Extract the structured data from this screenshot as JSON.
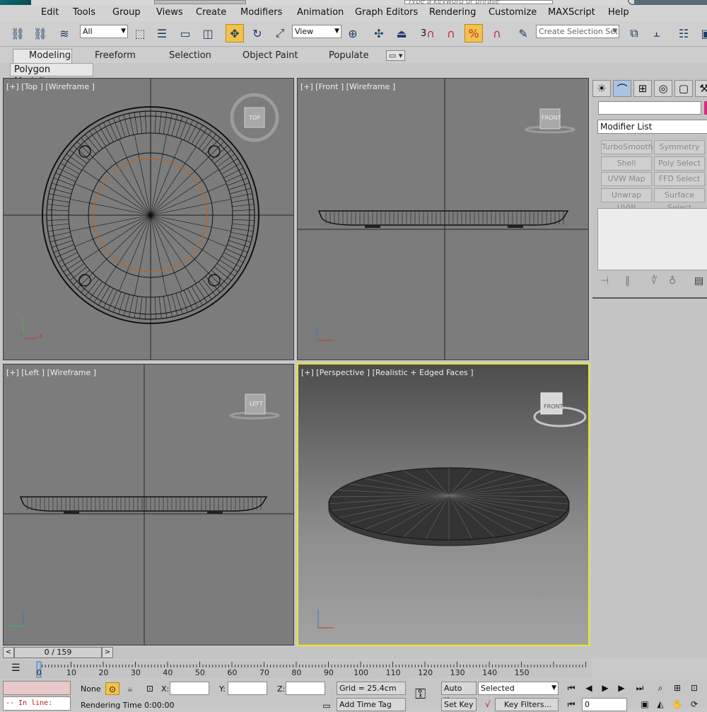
{
  "window": {
    "search_placeholder": "Type a keyword or phrase"
  },
  "menu": {
    "items": [
      "Edit",
      "Tools",
      "Group",
      "Views",
      "Create",
      "Modifiers",
      "Animation",
      "Graph Editors",
      "Rendering",
      "Customize",
      "MAXScript",
      "Help"
    ]
  },
  "toolbar": {
    "selection_filter": "All",
    "reference_coord": "View",
    "named_selection_placeholder": "Create Selection Set",
    "snap_label": "3"
  },
  "ribbon": {
    "tabs": [
      "Modeling",
      "Freeform",
      "Selection",
      "Object Paint",
      "Populate"
    ],
    "active_tab": "Modeling",
    "panel_label": "Polygon Modeling"
  },
  "viewports": {
    "top": {
      "label": "[+] [Top ] [Wireframe ]",
      "cube": "TOP"
    },
    "front": {
      "label": "[+] [Front ] [Wireframe ]",
      "cube": "FRONT"
    },
    "left": {
      "label": "[+] [Left ] [Wireframe ]",
      "cube": "LEFT"
    },
    "perspective": {
      "label": "[+] [Perspective ] [Realistic + Edged Faces ]",
      "cube": "FRONT"
    }
  },
  "command_panel": {
    "modifier_list": "Modifier List",
    "modifier_buttons": [
      "TurboSmooth",
      "Symmetry",
      "Shell",
      "Poly Select",
      "UVW Map",
      "FFD Select",
      "Unwrap UVW",
      "Surface Select"
    ]
  },
  "time_slider": {
    "position": "0 / 159",
    "prev": "<",
    "next": ">"
  },
  "trackbar": {
    "ticks": [
      "0",
      "10",
      "20",
      "30",
      "40",
      "50",
      "60",
      "70",
      "80",
      "90",
      "100",
      "110",
      "120",
      "130",
      "140",
      "150"
    ]
  },
  "status": {
    "maxscript_listener": "-- In line:",
    "selection": "None",
    "x_label": "X:",
    "y_label": "Y:",
    "z_label": "Z:",
    "grid": "Grid = 25.4cm",
    "rendering_time": "Rendering Time  0:00:00",
    "add_time_tag": "Add Time Tag",
    "auto_key": "Auto Key",
    "set_key": "Set Key",
    "key_mode": "Selected",
    "key_filters": "Key Filters...",
    "current_frame": "0"
  },
  "colors": {
    "active_viewport_border": "#f0e61e",
    "active_button": "#f2c24a",
    "viewport_bg": "#7c7c7c",
    "object_color": "#d0307f"
  }
}
